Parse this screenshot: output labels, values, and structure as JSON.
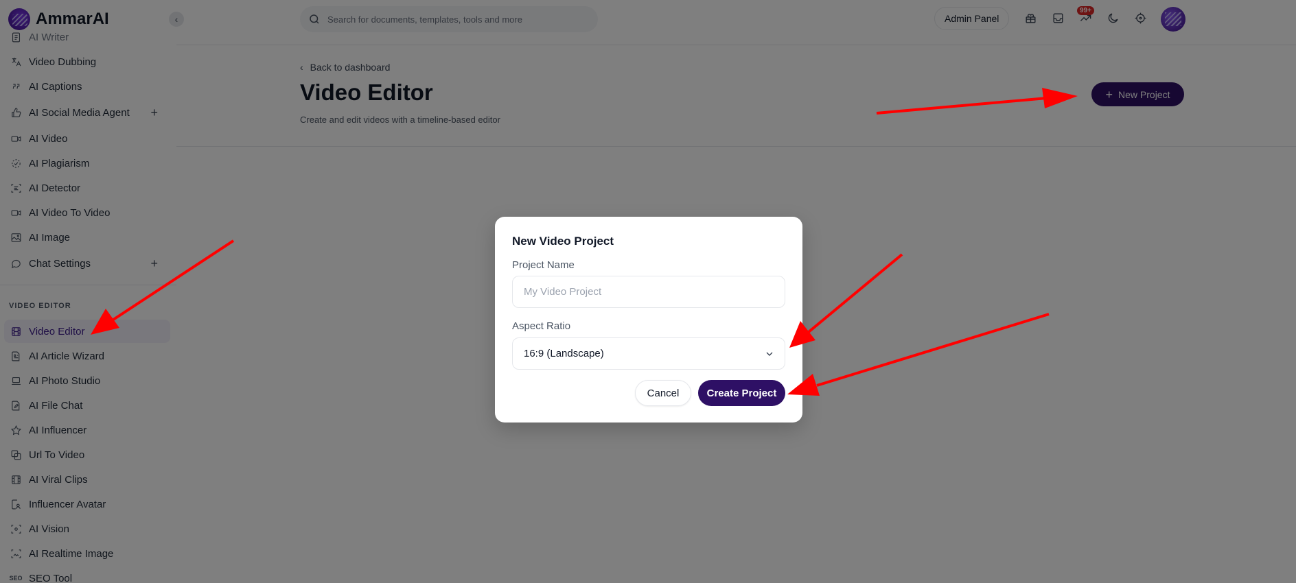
{
  "app": {
    "name": "AmmarAI"
  },
  "sidebar": {
    "items": [
      {
        "label": "AI Writer",
        "icon": "document-icon"
      },
      {
        "label": "Video Dubbing",
        "icon": "translate-icon"
      },
      {
        "label": "AI Captions",
        "icon": "quote-icon"
      },
      {
        "label": "AI Social Media Agent",
        "icon": "thumbs-up-icon",
        "expand": "+"
      },
      {
        "label": "AI Video",
        "icon": "video-camera-icon"
      },
      {
        "label": "AI Plagiarism",
        "icon": "dashed-check-icon"
      },
      {
        "label": "AI Detector",
        "icon": "scan-text-icon"
      },
      {
        "label": "AI Video To Video",
        "icon": "video-camera-icon"
      },
      {
        "label": "AI Image",
        "icon": "image-icon"
      },
      {
        "label": "Chat Settings",
        "icon": "chat-bubble-icon",
        "expand": "+"
      }
    ],
    "section_label": "VIDEO EDITOR",
    "section_items": [
      {
        "label": "Video Editor",
        "icon": "film-icon",
        "active": true
      },
      {
        "label": "AI Article Wizard",
        "icon": "article-icon"
      },
      {
        "label": "AI Photo Studio",
        "icon": "laptop-icon"
      },
      {
        "label": "AI File Chat",
        "icon": "file-edit-icon"
      },
      {
        "label": "AI Influencer",
        "icon": "star-icon"
      },
      {
        "label": "Url To Video",
        "icon": "copy-link-icon"
      },
      {
        "label": "AI Viral Clips",
        "icon": "film-icon"
      },
      {
        "label": "Influencer Avatar",
        "icon": "user-file-icon"
      },
      {
        "label": "AI Vision",
        "icon": "scan-eye-icon"
      },
      {
        "label": "AI Realtime Image",
        "icon": "image-scan-icon"
      },
      {
        "label": "SEO Tool",
        "icon": "seo-icon"
      }
    ]
  },
  "topbar": {
    "search_placeholder": "Search for documents, templates, tools and more",
    "admin_panel": "Admin Panel",
    "notification_badge": "99+"
  },
  "page": {
    "back_link": "Back to dashboard",
    "title": "Video Editor",
    "subtitle": "Create and edit videos with a timeline-based editor",
    "new_project_label": "New Project"
  },
  "modal": {
    "title": "New Video Project",
    "project_name_label": "Project Name",
    "project_name_placeholder": "My Video Project",
    "project_name_value": "",
    "aspect_ratio_label": "Aspect Ratio",
    "aspect_ratio_value": "16:9 (Landscape)",
    "cancel_label": "Cancel",
    "create_label": "Create Project"
  },
  "colors": {
    "brand": "#2e1065",
    "annotation": "#ff0000",
    "badge": "#dc2626"
  }
}
